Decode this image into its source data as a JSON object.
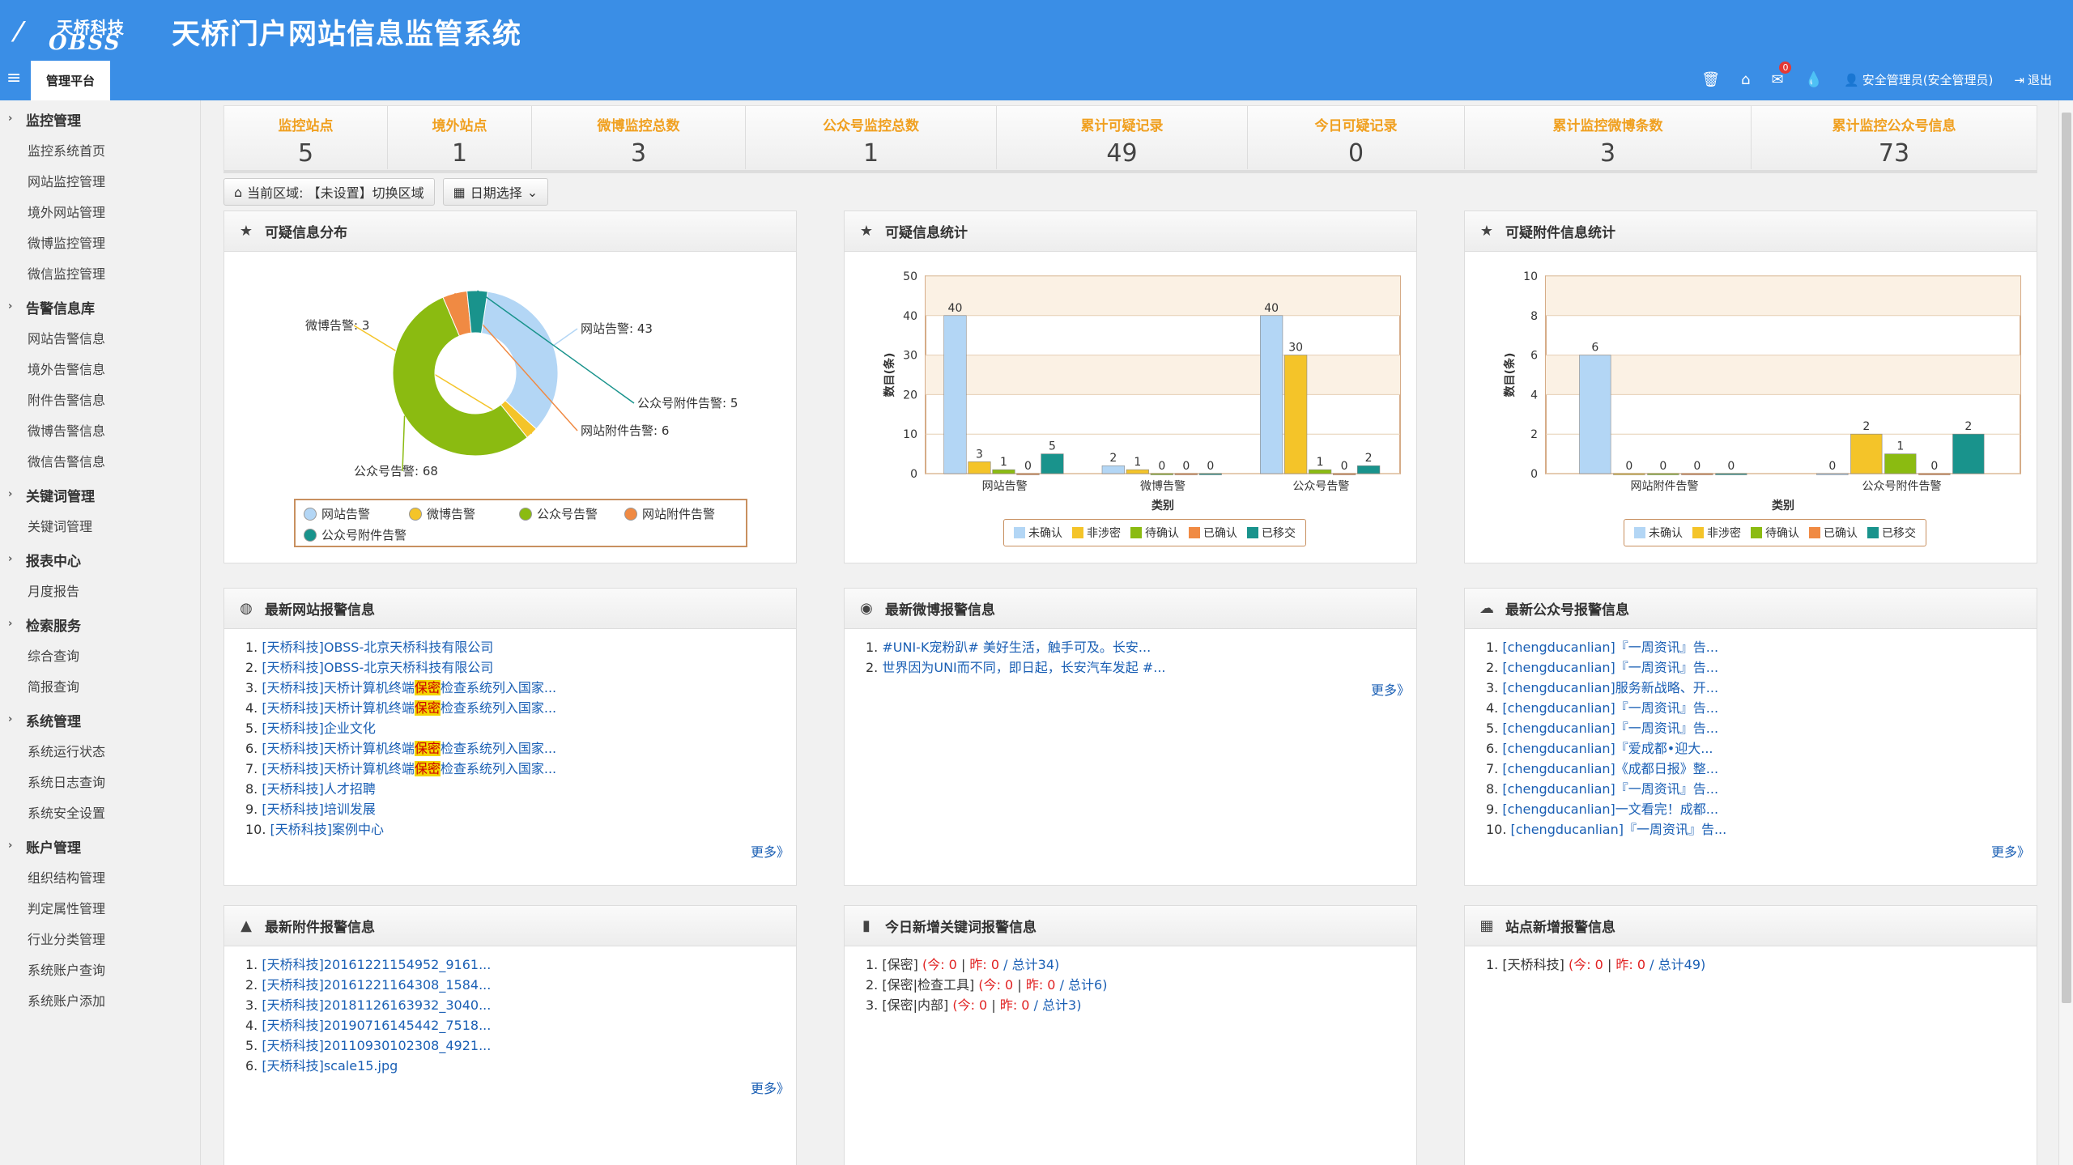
{
  "header": {
    "logo_top": "天桥科技",
    "logo_bottom": "OBSS",
    "title": "天桥门户网站信息监管系统",
    "platform_tab": "管理平台",
    "mail_count": "0",
    "user": "安全管理员(安全管理员)",
    "logout": "退出"
  },
  "sidebar": {
    "sections": [
      {
        "title": "监控管理",
        "items": [
          "监控系统首页",
          "网站监控管理",
          "境外网站管理",
          "微博监控管理",
          "微信监控管理"
        ]
      },
      {
        "title": "告警信息库",
        "items": [
          "网站告警信息",
          "境外告警信息",
          "附件告警信息",
          "微博告警信息",
          "微信告警信息"
        ]
      },
      {
        "title": "关键词管理",
        "items": [
          "关键词管理"
        ]
      },
      {
        "title": "报表中心",
        "items": [
          "月度报告"
        ]
      },
      {
        "title": "检索服务",
        "items": [
          "综合查询",
          "简报查询"
        ]
      },
      {
        "title": "系统管理",
        "items": [
          "系统运行状态",
          "系统日志查询",
          "系统安全设置"
        ]
      },
      {
        "title": "账户管理",
        "items": [
          "组织结构管理",
          "判定属性管理",
          "行业分类管理",
          "系统账户查询",
          "系统账户添加"
        ]
      }
    ]
  },
  "stats": [
    {
      "label": "监控站点",
      "value": "5"
    },
    {
      "label": "境外站点",
      "value": "1"
    },
    {
      "label": "微博监控总数",
      "value": "3"
    },
    {
      "label": "公众号监控总数",
      "value": "1"
    },
    {
      "label": "累计可疑记录",
      "value": "49"
    },
    {
      "label": "今日可疑记录",
      "value": "0"
    },
    {
      "label": "累计监控微博条数",
      "value": "3"
    },
    {
      "label": "累计监控公众号信息",
      "value": "73"
    }
  ],
  "region": {
    "label": "当前区域: 【未设置】切换区域",
    "date": "日期选择"
  },
  "panels": {
    "dist_title": "可疑信息分布",
    "stat_title": "可疑信息统计",
    "attach_title": "可疑附件信息统计",
    "site_alert_title": "最新网站报警信息",
    "weibo_alert_title": "最新微博报警信息",
    "wechat_alert_title": "最新公众号报警信息",
    "attach_alert_title": "最新附件报警信息",
    "keyword_alert_title": "今日新增关键词报警信息",
    "station_alert_title": "站点新增报警信息",
    "more": "更多》"
  },
  "site_alerts": [
    {
      "pre": "[天桥科技]OBSS-北京天桥科技有限公司",
      "hl": "",
      "post": ""
    },
    {
      "pre": "[天桥科技]OBSS-北京天桥科技有限公司",
      "hl": "",
      "post": ""
    },
    {
      "pre": "[天桥科技]天桥计算机终端",
      "hl": "保密",
      "post": "检查系统列入国家..."
    },
    {
      "pre": "[天桥科技]天桥计算机终端",
      "hl": "保密",
      "post": "检查系统列入国家..."
    },
    {
      "pre": "[天桥科技]企业文化",
      "hl": "",
      "post": ""
    },
    {
      "pre": "[天桥科技]天桥计算机终端",
      "hl": "保密",
      "post": "检查系统列入国家..."
    },
    {
      "pre": "[天桥科技]天桥计算机终端",
      "hl": "保密",
      "post": "检查系统列入国家..."
    },
    {
      "pre": "[天桥科技]人才招聘",
      "hl": "",
      "post": ""
    },
    {
      "pre": "[天桥科技]培训发展",
      "hl": "",
      "post": ""
    },
    {
      "pre": "[天桥科技]案例中心",
      "hl": "",
      "post": ""
    }
  ],
  "weibo_alerts": [
    "#UNI-K宠粉趴# 美好生活，触手可及。长安...",
    "世界因为UNI而不同，即日起，长安汽车发起 #..."
  ],
  "wechat_alerts": [
    "[chengducanlian]『一周资讯』告...",
    "[chengducanlian]『一周资讯』告...",
    "[chengducanlian]服务新战略、开...",
    "[chengducanlian]『一周资讯』告...",
    "[chengducanlian]『一周资讯』告...",
    "[chengducanlian]『爱成都•迎大...",
    "[chengducanlian]《成都日报》整...",
    "[chengducanlian]『一周资讯』告...",
    "[chengducanlian]一文看完！成都...",
    "[chengducanlian]『一周资讯』告..."
  ],
  "attach_alerts": [
    "[天桥科技]20161221154952_9161...",
    "[天桥科技]20161221164308_1584...",
    "[天桥科技]20181126163932_3040...",
    "[天桥科技]20190716145442_7518...",
    "[天桥科技]20110930102308_4921...",
    "[天桥科技]scale15.jpg"
  ],
  "keyword_alerts": [
    {
      "name": "[保密]",
      "today": "今: 0",
      "yest": "昨: 0",
      "total": "总计34"
    },
    {
      "name": "[保密|检查工具]",
      "today": "今: 0",
      "yest": "昨: 0",
      "total": "总计6"
    },
    {
      "name": "[保密|内部]",
      "today": "今: 0",
      "yest": "昨: 0",
      "total": "总计3"
    }
  ],
  "station_alerts": [
    {
      "name": "[天桥科技]",
      "today": "今: 0",
      "yest": "昨: 0",
      "total": "总计49"
    }
  ],
  "chart_data": [
    {
      "type": "pie",
      "title": "可疑信息分布",
      "donut": true,
      "slices": [
        {
          "name": "网站告警",
          "value": 43,
          "label": "网站告警: 43",
          "color": "#b3d6f5"
        },
        {
          "name": "微博告警",
          "value": 3,
          "label": "微博告警: 3",
          "color": "#f4c429"
        },
        {
          "name": "公众号告警",
          "value": 68,
          "label": "公众号告警: 68",
          "color": "#8bbb11"
        },
        {
          "name": "网站附件告警",
          "value": 6,
          "label": "网站附件告警: 6",
          "color": "#f08a43"
        },
        {
          "name": "公众号附件告警",
          "value": 5,
          "label": "公众号附件告警: 5",
          "color": "#19938c"
        }
      ]
    },
    {
      "type": "bar",
      "title": "可疑信息统计",
      "xlabel": "类别",
      "ylabel": "数目(条)",
      "ylim": [
        0,
        50
      ],
      "yticks": [
        0,
        10,
        20,
        30,
        40,
        50
      ],
      "categories": [
        "网站告警",
        "微博告警",
        "公众号告警"
      ],
      "series": [
        {
          "name": "未确认",
          "values": [
            40,
            2,
            40
          ],
          "color": "#b3d6f5"
        },
        {
          "name": "非涉密",
          "values": [
            3,
            1,
            30
          ],
          "color": "#f4c429"
        },
        {
          "name": "待确认",
          "values": [
            1,
            0,
            1
          ],
          "color": "#8bbb11"
        },
        {
          "name": "已确认",
          "values": [
            0,
            0,
            0
          ],
          "color": "#f08a43"
        },
        {
          "name": "已移交",
          "values": [
            5,
            0,
            2
          ],
          "color": "#19938c"
        }
      ]
    },
    {
      "type": "bar",
      "title": "可疑附件信息统计",
      "xlabel": "类别",
      "ylabel": "数目(条)",
      "ylim": [
        0,
        10
      ],
      "yticks": [
        0,
        2,
        4,
        6,
        8,
        10
      ],
      "categories": [
        "网站附件告警",
        "公众号附件告警"
      ],
      "series": [
        {
          "name": "未确认",
          "values": [
            6,
            0
          ],
          "color": "#b3d6f5"
        },
        {
          "name": "非涉密",
          "values": [
            0,
            2
          ],
          "color": "#f4c429"
        },
        {
          "name": "待确认",
          "values": [
            0,
            1
          ],
          "color": "#8bbb11"
        },
        {
          "name": "已确认",
          "values": [
            0,
            0
          ],
          "color": "#f08a43"
        },
        {
          "name": "已移交",
          "values": [
            0,
            2
          ],
          "color": "#19938c"
        }
      ]
    }
  ]
}
